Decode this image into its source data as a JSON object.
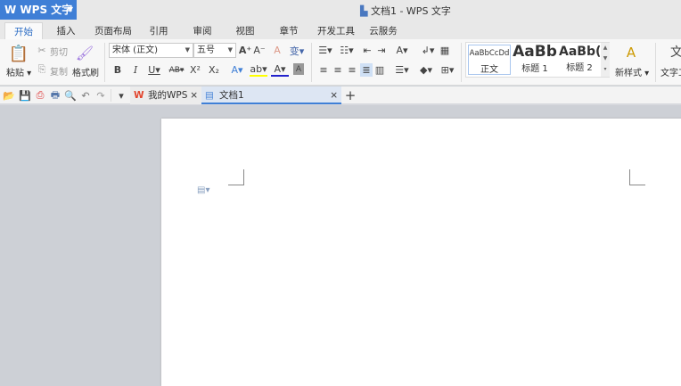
{
  "app": {
    "name": "WPS 文字",
    "window_title": "文档1 - WPS 文字"
  },
  "tabs": [
    "开始",
    "插入",
    "页面布局",
    "引用",
    "审阅",
    "视图",
    "章节",
    "开发工具",
    "云服务"
  ],
  "ribbon": {
    "paste": "粘贴",
    "cut": "剪切",
    "copy": "复制",
    "format_painter": "格式刷",
    "font": "宋体 (正文)",
    "size": "五号",
    "new_style": "新样式",
    "text_tools": "文字工"
  },
  "styles": [
    {
      "preview": "AaBbCcDd",
      "label": "正文"
    },
    {
      "preview": "AaBb",
      "label": "标题 1"
    },
    {
      "preview": "AaBb(",
      "label": "标题 2"
    }
  ],
  "doc_tabs": [
    {
      "label": "我的WPS"
    },
    {
      "label": "文档1"
    }
  ],
  "accent": "#3f7fd6"
}
